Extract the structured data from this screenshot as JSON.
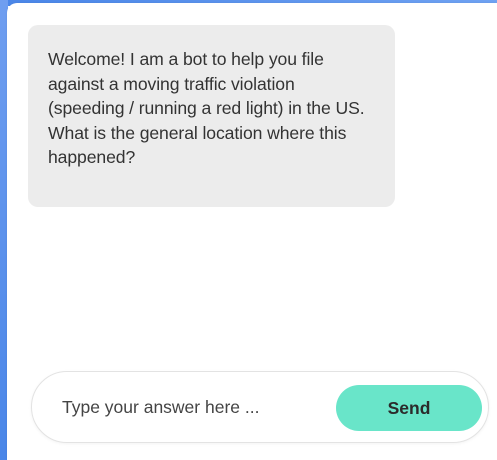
{
  "chat": {
    "bot_message": "Welcome! I am a bot to help you file against a moving traffic violation (speeding / running a red light) in the US. What is the general location where this happened?"
  },
  "composer": {
    "placeholder": "Type your answer here ...",
    "value": "",
    "send_label": "Send"
  },
  "colors": {
    "accent": "#69e5c9",
    "bubble": "#ececec",
    "frame": "#4a86e8"
  }
}
